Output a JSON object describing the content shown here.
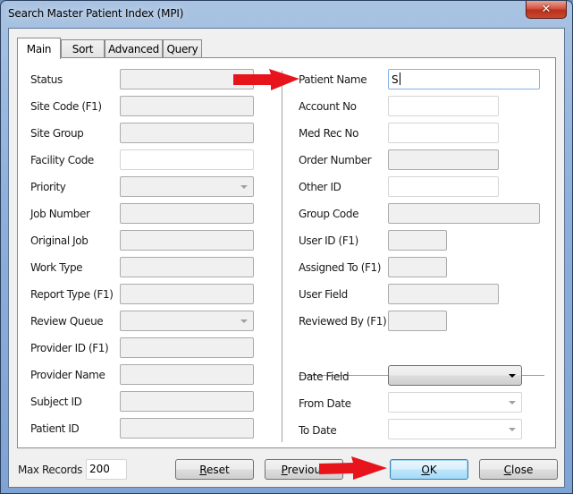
{
  "window": {
    "title": "Search Master Patient Index (MPI)",
    "close_icon": "close-x-icon"
  },
  "tabs": [
    {
      "label": "Main",
      "active": true
    },
    {
      "label": "Sort",
      "active": false
    },
    {
      "label": "Advanced",
      "active": false
    },
    {
      "label": "Query",
      "active": false
    }
  ],
  "left_fields": [
    {
      "label": "Status",
      "value": "",
      "kind": "disabled"
    },
    {
      "label": "Site Code (F1)",
      "value": "",
      "kind": "disabled"
    },
    {
      "label": "Site Group",
      "value": "",
      "kind": "disabled"
    },
    {
      "label": "Facility Code",
      "value": "",
      "kind": "text"
    },
    {
      "label": "Priority",
      "value": "",
      "kind": "dropdown-disabled"
    },
    {
      "label": "Job Number",
      "value": "",
      "kind": "disabled"
    },
    {
      "label": "Original Job",
      "value": "",
      "kind": "disabled"
    },
    {
      "label": "Work Type",
      "value": "",
      "kind": "disabled"
    },
    {
      "label": "Report Type (F1)",
      "value": "",
      "kind": "disabled"
    },
    {
      "label": "Review Queue",
      "value": "",
      "kind": "dropdown-disabled"
    },
    {
      "label": "Provider ID (F1)",
      "value": "",
      "kind": "disabled"
    },
    {
      "label": "Provider Name",
      "value": "",
      "kind": "disabled"
    },
    {
      "label": "Subject ID",
      "value": "",
      "kind": "disabled"
    },
    {
      "label": "Patient ID",
      "value": "",
      "kind": "disabled"
    }
  ],
  "right_fields": [
    {
      "label": "Patient Name",
      "value": "S",
      "kind": "focused"
    },
    {
      "label": "Account No",
      "value": "",
      "kind": "text"
    },
    {
      "label": "Med Rec No",
      "value": "",
      "kind": "text"
    },
    {
      "label": "Order Number",
      "value": "",
      "kind": "disabled"
    },
    {
      "label": "Other ID",
      "value": "",
      "kind": "text"
    },
    {
      "label": "Group Code",
      "value": "",
      "kind": "disabled"
    },
    {
      "label": "User ID (F1)",
      "value": "",
      "kind": "disabled"
    },
    {
      "label": "Assigned To (F1)",
      "value": "",
      "kind": "disabled"
    },
    {
      "label": "User Field",
      "value": "",
      "kind": "disabled"
    },
    {
      "label": "Reviewed By (F1)",
      "value": "",
      "kind": "disabled"
    }
  ],
  "date_fields": [
    {
      "label": "Date Field",
      "value": "",
      "kind": "dropdown"
    },
    {
      "label": "From Date",
      "value": "",
      "kind": "dropdown-disabled"
    },
    {
      "label": "To Date",
      "value": "",
      "kind": "dropdown-disabled"
    }
  ],
  "footer": {
    "max_records_label": "Max Records",
    "max_records_value": "200",
    "buttons": [
      {
        "label": "Reset",
        "mnemonic": "R",
        "rest": "eset"
      },
      {
        "label": "Previous",
        "mnemonic": "P",
        "rest": "revious"
      },
      {
        "label": "OK",
        "mnemonic": "O",
        "rest": "K",
        "default": true
      },
      {
        "label": "Close",
        "mnemonic": "C",
        "rest": "lose"
      }
    ]
  },
  "annotations": {
    "arrow_color": "#e8141c",
    "arrows": [
      "points-to-patient-name",
      "points-to-ok-button"
    ]
  }
}
